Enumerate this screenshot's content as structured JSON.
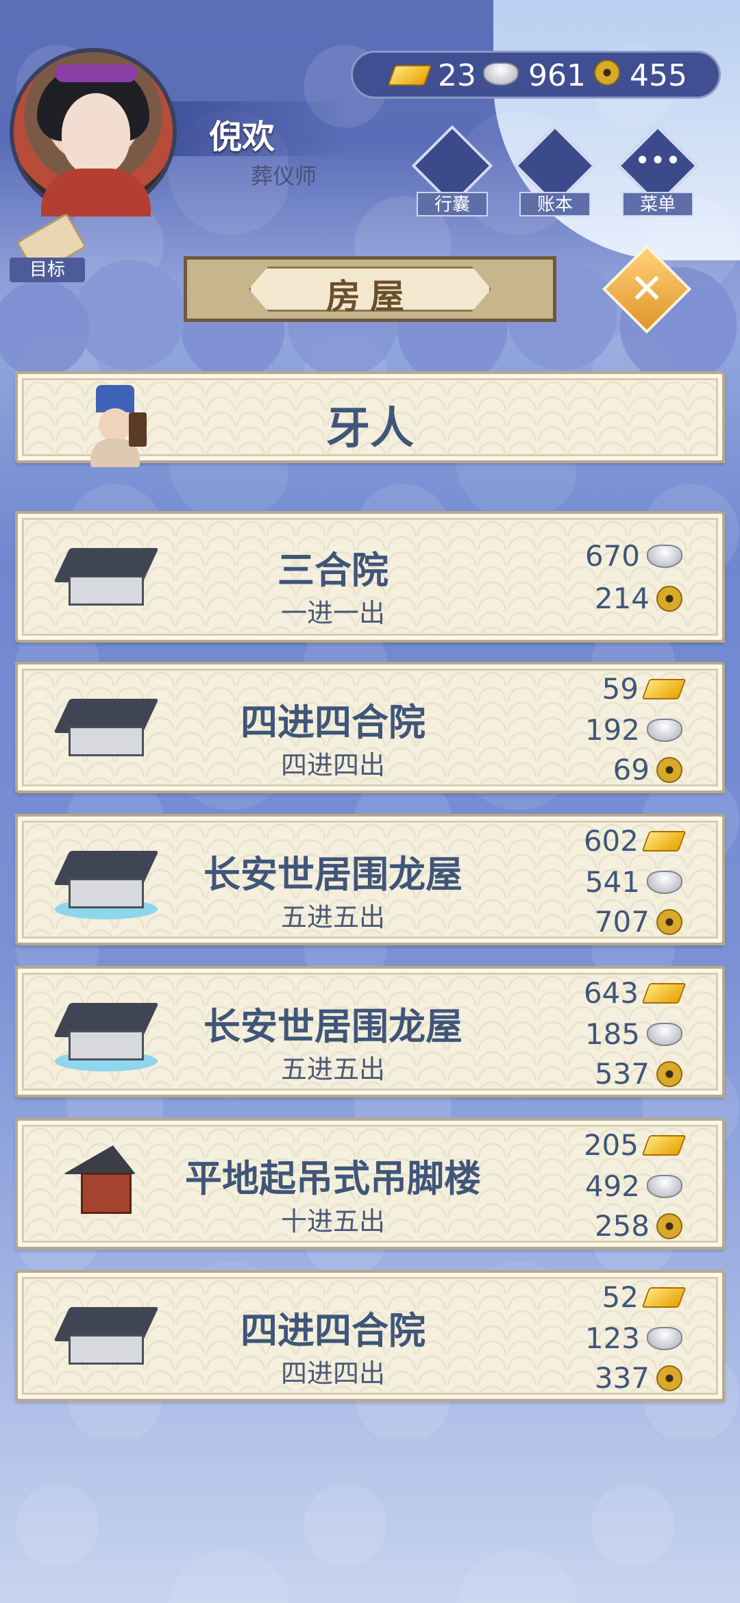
{
  "player": {
    "name": "倪欢",
    "title": "葬仪师"
  },
  "goal_label": "目标",
  "currency": {
    "gold": "23",
    "silver": "961",
    "copper": "455"
  },
  "nav": {
    "bag": "行囊",
    "ledger": "账本",
    "menu": "菜单",
    "menu_glyph": "•••"
  },
  "header": {
    "title": "房屋",
    "close_glyph": "✕"
  },
  "broker": {
    "label": "牙人"
  },
  "houses": [
    {
      "name": "三合院",
      "layout": "一进一出",
      "prices": {
        "silver": "670",
        "copper": "214"
      }
    },
    {
      "name": "四进四合院",
      "layout": "四进四出",
      "prices": {
        "gold": "59",
        "silver": "192",
        "copper": "69"
      }
    },
    {
      "name": "长安世居围龙屋",
      "layout": "五进五出",
      "prices": {
        "gold": "602",
        "silver": "541",
        "copper": "707"
      }
    },
    {
      "name": "长安世居围龙屋",
      "layout": "五进五出",
      "prices": {
        "gold": "643",
        "silver": "185",
        "copper": "537"
      }
    },
    {
      "name": "平地起吊式吊脚楼",
      "layout": "十进五出",
      "prices": {
        "gold": "205",
        "silver": "492",
        "copper": "258"
      }
    },
    {
      "name": "四进四合院",
      "layout": "四进四出",
      "prices": {
        "gold": "52",
        "silver": "123",
        "copper": "337"
      }
    }
  ],
  "icons": {
    "gold": "gold-ingot-icon",
    "silver": "silver-ingot-icon",
    "copper": "copper-coin-icon"
  }
}
